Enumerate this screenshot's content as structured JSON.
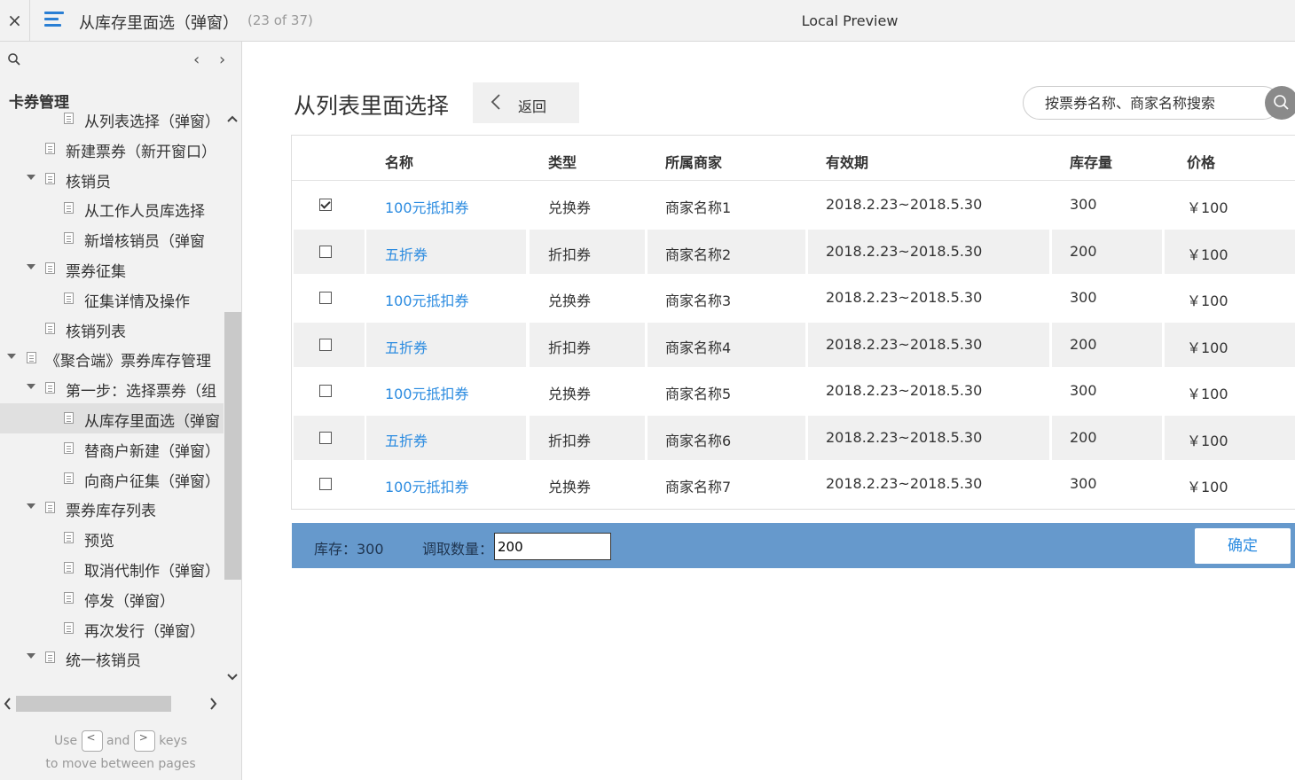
{
  "topbar": {
    "close_glyph": "×",
    "menu_icon": "hamburger-icon",
    "title": "从库存里面选（弹窗）",
    "counter": "(23 of 37)",
    "preview_label": "Local Preview"
  },
  "sidebar": {
    "heading": "卡券管理",
    "nav_prev": "‹",
    "nav_next": "›",
    "items": [
      {
        "label": "从列表选择（弹窗）",
        "level": 2,
        "twisty": false,
        "active": false
      },
      {
        "label": "新建票券（新开窗口）",
        "level": 1,
        "twisty": false,
        "active": false
      },
      {
        "label": "核销员",
        "level": 1,
        "twisty": true,
        "active": false
      },
      {
        "label": "从工作人员库选择",
        "level": 2,
        "twisty": false,
        "active": false
      },
      {
        "label": "新增核销员（弹窗",
        "level": 2,
        "twisty": false,
        "active": false
      },
      {
        "label": "票券征集",
        "level": 1,
        "twisty": true,
        "active": false
      },
      {
        "label": "征集详情及操作",
        "level": 2,
        "twisty": false,
        "active": false
      },
      {
        "label": "核销列表",
        "level": 1,
        "twisty": false,
        "active": false
      },
      {
        "label": "《聚合端》票券库存管理",
        "level": 0,
        "twisty": true,
        "active": false
      },
      {
        "label": "第一步：选择票券（组",
        "level": 1,
        "twisty": true,
        "active": false
      },
      {
        "label": "从库存里面选（弹窗",
        "level": 2,
        "twisty": false,
        "active": true
      },
      {
        "label": "替商户新建（弹窗）",
        "level": 2,
        "twisty": false,
        "active": false
      },
      {
        "label": "向商户征集（弹窗）",
        "level": 2,
        "twisty": false,
        "active": false
      },
      {
        "label": "票券库存列表",
        "level": 1,
        "twisty": true,
        "active": false
      },
      {
        "label": "预览",
        "level": 2,
        "twisty": false,
        "active": false
      },
      {
        "label": "取消代制作（弹窗）",
        "level": 2,
        "twisty": false,
        "active": false
      },
      {
        "label": "停发（弹窗）",
        "level": 2,
        "twisty": false,
        "active": false
      },
      {
        "label": "再次发行（弹窗）",
        "level": 2,
        "twisty": false,
        "active": false
      },
      {
        "label": "统一核销员",
        "level": 1,
        "twisty": true,
        "active": false
      }
    ],
    "hint": {
      "use": "Use",
      "key_prev": "<",
      "and": "and",
      "key_next": ">",
      "keys": "keys",
      "line2": "to move between pages"
    }
  },
  "main": {
    "title": "从列表里面选择",
    "back_label": "返回",
    "search_placeholder": "按票券名称、商家名称搜索",
    "table": {
      "headers": [
        "名称",
        "类型",
        "所属商家",
        "有效期",
        "库存量",
        "价格"
      ],
      "rows": [
        {
          "checked": true,
          "name": "100元抵扣券",
          "type": "兑换券",
          "merchant": "商家名称1",
          "validity": "2018.2.23~2018.5.30",
          "stock": "300",
          "price": "￥100"
        },
        {
          "checked": false,
          "name": "五折券",
          "type": "折扣券",
          "merchant": "商家名称2",
          "validity": "2018.2.23~2018.5.30",
          "stock": "200",
          "price": "￥100"
        },
        {
          "checked": false,
          "name": "100元抵扣券",
          "type": "兑换券",
          "merchant": "商家名称3",
          "validity": "2018.2.23~2018.5.30",
          "stock": "300",
          "price": "￥100"
        },
        {
          "checked": false,
          "name": "五折券",
          "type": "折扣券",
          "merchant": "商家名称4",
          "validity": "2018.2.23~2018.5.30",
          "stock": "200",
          "price": "￥100"
        },
        {
          "checked": false,
          "name": "100元抵扣券",
          "type": "兑换券",
          "merchant": "商家名称5",
          "validity": "2018.2.23~2018.5.30",
          "stock": "300",
          "price": "￥100"
        },
        {
          "checked": false,
          "name": "五折券",
          "type": "折扣券",
          "merchant": "商家名称6",
          "validity": "2018.2.23~2018.5.30",
          "stock": "200",
          "price": "￥100"
        },
        {
          "checked": false,
          "name": "100元抵扣券",
          "type": "兑换券",
          "merchant": "商家名称7",
          "validity": "2018.2.23~2018.5.30",
          "stock": "300",
          "price": "￥100"
        }
      ]
    },
    "footer": {
      "stock_text": "库存：300",
      "qty_label": "调取数量：",
      "qty_value": "200",
      "confirm_label": "确定"
    }
  },
  "colors": {
    "accent": "#2b8be0",
    "footer_bar": "#6699cc",
    "sidebar_bg": "#f2f2f2"
  }
}
